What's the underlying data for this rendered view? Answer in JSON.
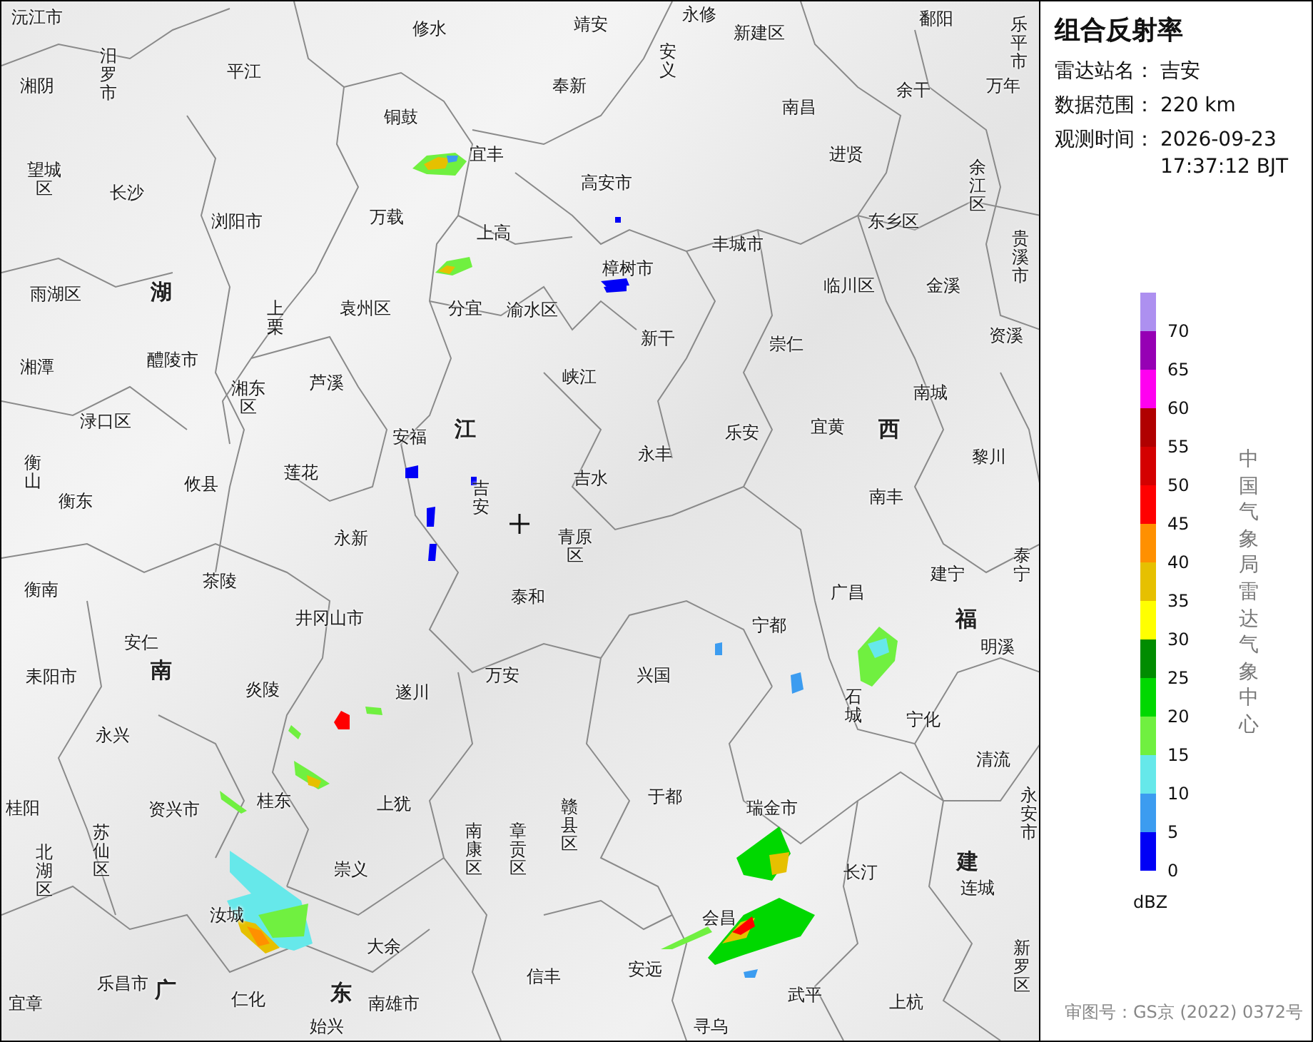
{
  "map": {
    "labels": [
      {
        "text": "沅江市",
        "kind": "county"
      },
      {
        "text": "湘阴",
        "kind": "county"
      },
      {
        "text": "汨罗市",
        "kind": "county"
      },
      {
        "text": "平江",
        "kind": "county"
      },
      {
        "text": "修水",
        "kind": "county"
      },
      {
        "text": "铜鼓",
        "kind": "county"
      },
      {
        "text": "宜丰",
        "kind": "county"
      },
      {
        "text": "望城区",
        "kind": "county"
      },
      {
        "text": "长沙",
        "kind": "county"
      },
      {
        "text": "浏阳市",
        "kind": "county"
      },
      {
        "text": "万载",
        "kind": "county"
      },
      {
        "text": "上高",
        "kind": "county"
      },
      {
        "text": "雨湖区",
        "kind": "county"
      },
      {
        "text": "湖",
        "kind": "province"
      },
      {
        "text": "上栗",
        "kind": "county"
      },
      {
        "text": "袁州区",
        "kind": "county"
      },
      {
        "text": "分宜",
        "kind": "county"
      },
      {
        "text": "湘潭",
        "kind": "county"
      },
      {
        "text": "醴陵市",
        "kind": "county"
      },
      {
        "text": "湘东区",
        "kind": "county"
      },
      {
        "text": "芦溪",
        "kind": "county"
      },
      {
        "text": "渌口区",
        "kind": "county"
      },
      {
        "text": "安福",
        "kind": "county"
      },
      {
        "text": "江",
        "kind": "province"
      },
      {
        "text": "衡山",
        "kind": "county"
      },
      {
        "text": "衡东",
        "kind": "county"
      },
      {
        "text": "攸县",
        "kind": "county"
      },
      {
        "text": "莲花",
        "kind": "county"
      },
      {
        "text": "吉安",
        "kind": "county"
      },
      {
        "text": "永新",
        "kind": "county"
      },
      {
        "text": "衡南",
        "kind": "county"
      },
      {
        "text": "茶陵",
        "kind": "county"
      },
      {
        "text": "井冈山市",
        "kind": "county"
      },
      {
        "text": "安仁",
        "kind": "county"
      },
      {
        "text": "耒阳市",
        "kind": "county"
      },
      {
        "text": "南",
        "kind": "province"
      },
      {
        "text": "炎陵",
        "kind": "county"
      },
      {
        "text": "遂川",
        "kind": "county"
      },
      {
        "text": "万安",
        "kind": "county"
      },
      {
        "text": "永兴",
        "kind": "county"
      },
      {
        "text": "桂阳",
        "kind": "county"
      },
      {
        "text": "资兴市",
        "kind": "county"
      },
      {
        "text": "桂东",
        "kind": "county"
      },
      {
        "text": "上犹",
        "kind": "county"
      },
      {
        "text": "北湖区",
        "kind": "county"
      },
      {
        "text": "苏仙区",
        "kind": "county"
      },
      {
        "text": "崇义",
        "kind": "county"
      },
      {
        "text": "南康区",
        "kind": "county"
      },
      {
        "text": "章贡区",
        "kind": "county"
      },
      {
        "text": "汝城",
        "kind": "county"
      },
      {
        "text": "大余",
        "kind": "county"
      },
      {
        "text": "宜章",
        "kind": "county"
      },
      {
        "text": "乐昌市",
        "kind": "county"
      },
      {
        "text": "广",
        "kind": "province"
      },
      {
        "text": "仁化",
        "kind": "county"
      },
      {
        "text": "东",
        "kind": "province"
      },
      {
        "text": "南雄市",
        "kind": "county"
      },
      {
        "text": "始兴",
        "kind": "county"
      },
      {
        "text": "靖安",
        "kind": "county"
      },
      {
        "text": "安义",
        "kind": "county"
      },
      {
        "text": "永修",
        "kind": "county"
      },
      {
        "text": "新建区",
        "kind": "county"
      },
      {
        "text": "鄱阳",
        "kind": "county"
      },
      {
        "text": "乐平市",
        "kind": "county"
      },
      {
        "text": "奉新",
        "kind": "county"
      },
      {
        "text": "南昌",
        "kind": "county"
      },
      {
        "text": "余干",
        "kind": "county"
      },
      {
        "text": "万年",
        "kind": "county"
      },
      {
        "text": "高安市",
        "kind": "county"
      },
      {
        "text": "进贤",
        "kind": "county"
      },
      {
        "text": "余江区",
        "kind": "county"
      },
      {
        "text": "樟树市",
        "kind": "county"
      },
      {
        "text": "丰城市",
        "kind": "county"
      },
      {
        "text": "东乡区",
        "kind": "county"
      },
      {
        "text": "贵溪市",
        "kind": "county"
      },
      {
        "text": "渝水区",
        "kind": "county"
      },
      {
        "text": "临川区",
        "kind": "county"
      },
      {
        "text": "金溪",
        "kind": "county"
      },
      {
        "text": "新干",
        "kind": "county"
      },
      {
        "text": "崇仁",
        "kind": "county"
      },
      {
        "text": "资溪",
        "kind": "county"
      },
      {
        "text": "峡江",
        "kind": "county"
      },
      {
        "text": "南城",
        "kind": "county"
      },
      {
        "text": "永丰",
        "kind": "county"
      },
      {
        "text": "乐安",
        "kind": "county"
      },
      {
        "text": "宜黄",
        "kind": "county"
      },
      {
        "text": "西",
        "kind": "province"
      },
      {
        "text": "黎川",
        "kind": "county"
      },
      {
        "text": "吉水",
        "kind": "county"
      },
      {
        "text": "南丰",
        "kind": "county"
      },
      {
        "text": "青原区",
        "kind": "county"
      },
      {
        "text": "泰和",
        "kind": "county"
      },
      {
        "text": "广昌",
        "kind": "county"
      },
      {
        "text": "建宁",
        "kind": "county"
      },
      {
        "text": "泰宁",
        "kind": "county"
      },
      {
        "text": "宁都",
        "kind": "county"
      },
      {
        "text": "福",
        "kind": "province"
      },
      {
        "text": "明溪",
        "kind": "county"
      },
      {
        "text": "兴国",
        "kind": "county"
      },
      {
        "text": "石城",
        "kind": "county"
      },
      {
        "text": "宁化",
        "kind": "county"
      },
      {
        "text": "清流",
        "kind": "county"
      },
      {
        "text": "赣县区",
        "kind": "county"
      },
      {
        "text": "于都",
        "kind": "county"
      },
      {
        "text": "瑞金市",
        "kind": "county"
      },
      {
        "text": "永安市",
        "kind": "county"
      },
      {
        "text": "长汀",
        "kind": "county"
      },
      {
        "text": "建",
        "kind": "province"
      },
      {
        "text": "连城",
        "kind": "county"
      },
      {
        "text": "会昌",
        "kind": "county"
      },
      {
        "text": "信丰",
        "kind": "county"
      },
      {
        "text": "安远",
        "kind": "county"
      },
      {
        "text": "武平",
        "kind": "county"
      },
      {
        "text": "上杭",
        "kind": "county"
      },
      {
        "text": "新罗区",
        "kind": "county"
      },
      {
        "text": "寻乌",
        "kind": "county"
      }
    ]
  },
  "panel": {
    "title": "组合反射率",
    "info": [
      {
        "label": "雷达站名：",
        "value": "吉安"
      },
      {
        "label": "数据范围：",
        "value": "220 km"
      },
      {
        "label": "观测时间：",
        "value": "2026-09-23 17:37:12 BJT"
      }
    ],
    "legend": {
      "unit": "dBZ",
      "segments": [
        {
          "color": "#ad90f0",
          "label": "70"
        },
        {
          "color": "#9600b4",
          "label": "65"
        },
        {
          "color": "#ff00f0",
          "label": "60"
        },
        {
          "color": "#b00000",
          "label": "55"
        },
        {
          "color": "#d40000",
          "label": "50"
        },
        {
          "color": "#ff0000",
          "label": "45"
        },
        {
          "color": "#ff9000",
          "label": "40"
        },
        {
          "color": "#e6c000",
          "label": "35"
        },
        {
          "color": "#ffff00",
          "label": "30"
        },
        {
          "color": "#008c00",
          "label": "25"
        },
        {
          "color": "#00d800",
          "label": "20"
        },
        {
          "color": "#70f040",
          "label": "15"
        },
        {
          "color": "#66e8ea",
          "label": "10"
        },
        {
          "color": "#3c9cf0",
          "label": "5"
        },
        {
          "color": "#0000f6",
          "label": "0"
        }
      ]
    },
    "credit": "中国气象局雷达气象中心",
    "footer": "审图号：GS京 (2022) 0372号"
  }
}
